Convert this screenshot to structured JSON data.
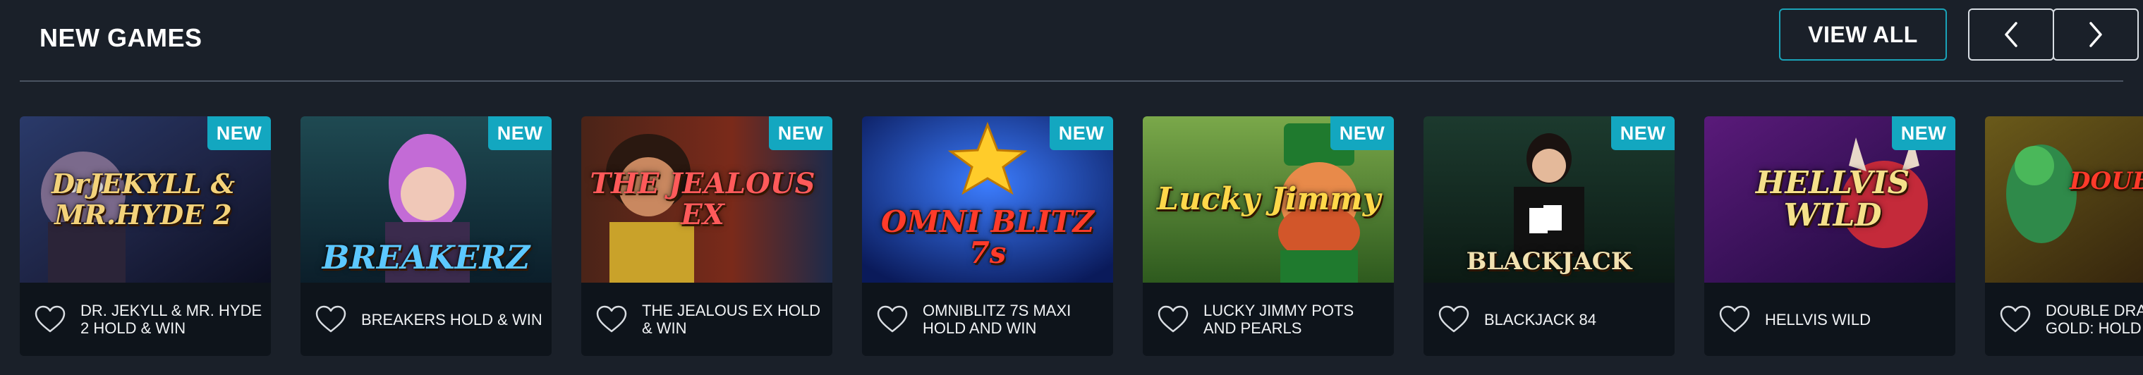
{
  "section": {
    "title": "NEW GAMES",
    "view_all_label": "VIEW ALL",
    "prev_icon": "chevron-left-icon",
    "next_icon": "chevron-right-icon"
  },
  "colors": {
    "background": "#1a2029",
    "card": "#0e141b",
    "badge": "#13a7c0",
    "view_all_border": "#1aa3b8"
  },
  "games": [
    {
      "name": "DR. JEKYLL & MR. HYDE 2 HOLD & WIN",
      "badge": "NEW",
      "logo": "DrJEKYLL & MR.HYDE 2",
      "favorite_icon": "heart-outline-icon"
    },
    {
      "name": "BREAKERS HOLD & WIN",
      "badge": "NEW",
      "logo": "BREAKERZ",
      "favorite_icon": "heart-outline-icon"
    },
    {
      "name": "THE JEALOUS EX HOLD & WIN",
      "badge": "NEW",
      "logo": "THE JEALOUS EX",
      "favorite_icon": "heart-outline-icon"
    },
    {
      "name": "OMNIBLITZ 7S MAXI HOLD AND WIN",
      "badge": "NEW",
      "logo": "OMNI BLITZ 7s",
      "favorite_icon": "heart-outline-icon"
    },
    {
      "name": "LUCKY JIMMY POTS AND PEARLS",
      "badge": "NEW",
      "logo": "Lucky Jimmy",
      "favorite_icon": "heart-outline-icon"
    },
    {
      "name": "BLACKJACK 84",
      "badge": "NEW",
      "logo": "BLACKJACK",
      "favorite_icon": "heart-outline-icon"
    },
    {
      "name": "HELLVIS WILD",
      "badge": "NEW",
      "logo": "HELLVIS WILD",
      "favorite_icon": "heart-outline-icon"
    },
    {
      "name": "DOUBLE DRAGON GOLD: HOLD & WIN",
      "badge": "",
      "logo": "DOUBLE",
      "favorite_icon": "heart-outline-icon"
    }
  ]
}
